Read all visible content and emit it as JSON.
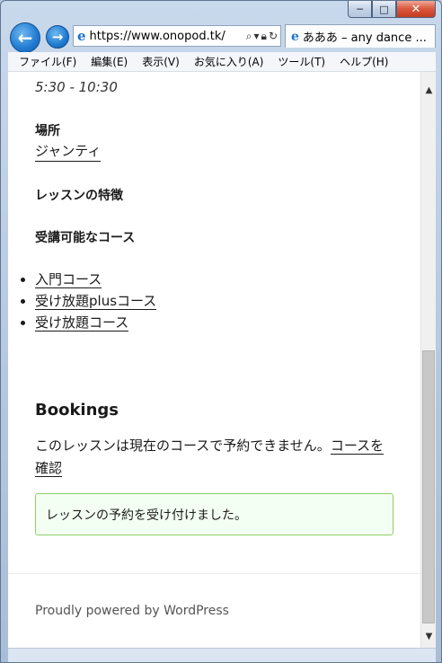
{
  "browser": {
    "caption": {
      "minimize": "─",
      "maximize": "□",
      "close": "✕"
    },
    "back_glyph": "←",
    "forward_glyph": "→",
    "address": "https://www.onopod.tk/",
    "address_icons": [
      "search-icon",
      "lock-icon",
      "refresh-icon"
    ],
    "tab_title": "あああ – any dance ...",
    "menu": [
      "ファイル(F)",
      "編集(E)",
      "表示(V)",
      "お気に入り(A)",
      "ツール(T)",
      "ヘルプ(H)"
    ]
  },
  "page": {
    "time": "5:30 - 10:30",
    "location_heading": "場所",
    "location_link": "ジャンティ",
    "features_heading": "レッスンの特徴",
    "courses_heading": "受講可能なコース",
    "courses": [
      "入門コース",
      "受け放題plusコース",
      "受け放題コース"
    ],
    "bookings_title": "Bookings",
    "bookings_note": "このレッスンは現在のコースで予約できません。",
    "bookings_link": "コースを確認",
    "success_message": "レッスンの予約を受け付けました。",
    "footer": "Proudly powered by WordPress"
  },
  "colors": {
    "success_border": "#8dd06a",
    "success_bg": "#f4fff3",
    "ie_blue": "#1f7ad0"
  }
}
